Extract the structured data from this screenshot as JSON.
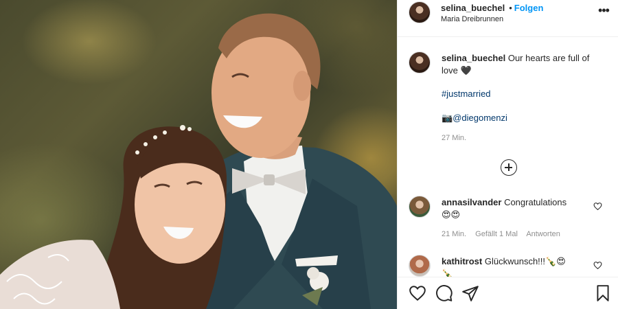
{
  "header": {
    "username": "selina_buechel",
    "separator": "•",
    "follow_label": "Folgen",
    "location": "Maria Dreibrunnen",
    "more_label": "•••"
  },
  "caption": {
    "username": "selina_buechel",
    "text": "Our hearts are full of love 🖤",
    "hashtag": "#justmarried",
    "credit_icon": "📷",
    "credit": "@diegomenzi",
    "time": "27 Min."
  },
  "load_more_icon": "plus-circle-icon",
  "comments": [
    {
      "username": "annasilvander",
      "text": "Congratulations",
      "emoji_line": "😍😍",
      "time": "21 Min.",
      "likes": "Gefällt 1 Mal",
      "reply_label": "Antworten"
    },
    {
      "username": "kathitrost",
      "text": "Glückwunsch!!!🍾😍",
      "emoji_line": "🍾"
    }
  ],
  "actions": {
    "like_icon": "heart-icon",
    "comment_icon": "comment-icon",
    "share_icon": "paper-plane-icon",
    "save_icon": "bookmark-icon"
  }
}
